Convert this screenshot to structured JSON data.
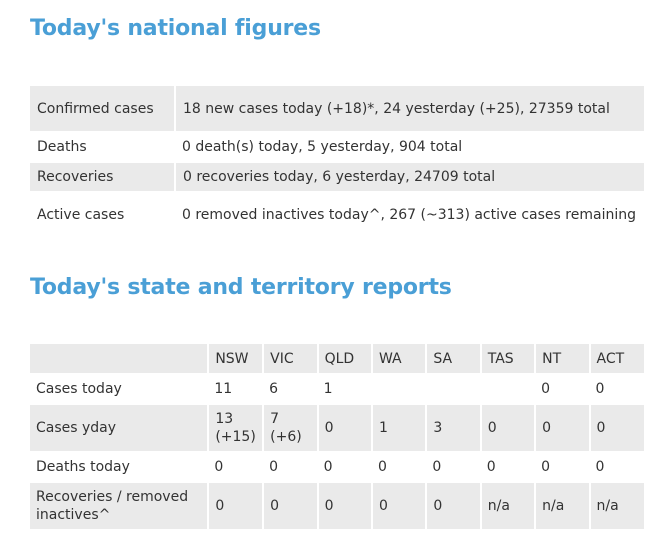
{
  "national": {
    "title": "Today's national figures",
    "rows": [
      {
        "label": "Confirmed cases",
        "value": "18 new cases today (+18)*, 24 yesterday (+25), 27359 total"
      },
      {
        "label": "Deaths",
        "value": "0 death(s) today, 5 yesterday, 904 total"
      },
      {
        "label": "Recoveries",
        "value": "0 recoveries today, 6 yesterday, 24709 total"
      },
      {
        "label": "Active cases",
        "value": "0 removed inactives today^, 267 (~313) active cases remaining"
      }
    ]
  },
  "states": {
    "title": "Today's state and territory reports",
    "columns": [
      "NSW",
      "VIC",
      "QLD",
      "WA",
      "SA",
      "TAS",
      "NT",
      "ACT"
    ],
    "rows": [
      {
        "label": "Cases today",
        "cells": [
          "11",
          "6",
          "1",
          "",
          "",
          "",
          "0",
          "0"
        ]
      },
      {
        "label": "Cases yday",
        "cells": [
          "13 (+15)",
          "7 (+6)",
          "0",
          "1",
          "3",
          "0",
          "0",
          "0"
        ]
      },
      {
        "label": "Deaths today",
        "cells": [
          "0",
          "0",
          "0",
          "0",
          "0",
          "0",
          "0",
          "0"
        ]
      },
      {
        "label": "Recoveries / removed inactives^",
        "cells": [
          "0",
          "0",
          "0",
          "0",
          "0",
          "n/a",
          "n/a",
          "n/a"
        ]
      }
    ]
  }
}
